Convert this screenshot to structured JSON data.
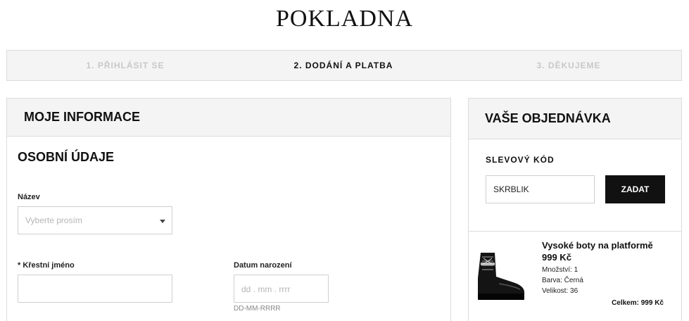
{
  "page": {
    "title": "POKLADNA"
  },
  "steps": [
    {
      "label": "1. PŘIHLÁSIT SE",
      "state": "inactive"
    },
    {
      "label": "2. DODÁNÍ A PLATBA",
      "state": "active"
    },
    {
      "label": "3. DĚKUJEME",
      "state": "inactive"
    }
  ],
  "info": {
    "header": "MOJE INFORMACE",
    "section_title": "OSOBNÍ ÚDAJE",
    "title_field": {
      "label": "Název",
      "placeholder": "Vyberte prosím"
    },
    "first_name": {
      "label": "* Křestní jméno",
      "value": ""
    },
    "birth_date": {
      "label": "Datum narození",
      "placeholder": "dd  . mm . rrrr",
      "hint": "DD-MM-RRRR"
    }
  },
  "order": {
    "header": "VAŠE OBJEDNÁVKA",
    "discount": {
      "label": "SLEVOVÝ KÓD",
      "value": "SKRBLIK",
      "button": "ZADAT"
    },
    "item": {
      "image_icon": "boot-image",
      "name": "Vysoké boty na platformě",
      "price": "999 Kč",
      "quantity": "Množství: 1",
      "color": "Barva: Černá",
      "size": "Velikost: 36",
      "total": "Celkem:  999 Kč"
    }
  },
  "colors": {
    "accent": "#111111",
    "border": "#dcdcdc",
    "header_bg": "#f4f4f4"
  }
}
